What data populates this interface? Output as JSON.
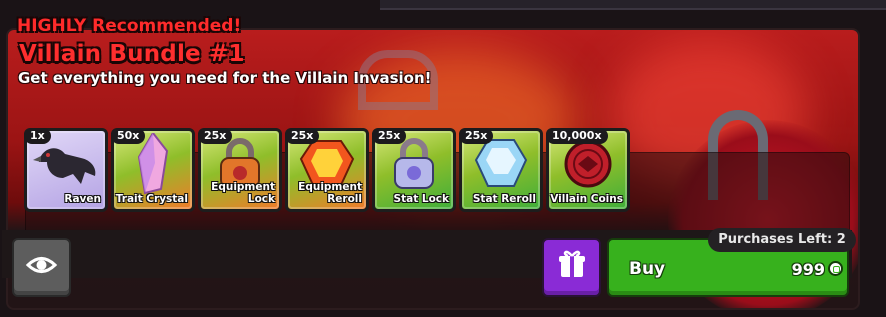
{
  "header": {
    "highlight": "HIGHLY Recommended!",
    "title": "Villain Bundle #1",
    "subtitle": "Get everything you need for the Villain Invasion!"
  },
  "items": [
    {
      "qty": "1x",
      "name": "Raven",
      "icon": "raven-icon",
      "bg": "#c8b8ee"
    },
    {
      "qty": "50x",
      "name": "Trait Crystal",
      "icon": "trait-crystal-icon",
      "bg": "#b8d84a"
    },
    {
      "qty": "25x",
      "name": "Equipment Lock",
      "name_line1": "Equipment",
      "name_line2": "Lock",
      "icon": "equipment-lock-icon",
      "bg": "#b8d84a"
    },
    {
      "qty": "25x",
      "name": "Equipment Reroll",
      "name_line1": "Equipment",
      "name_line2": "Reroll",
      "icon": "equipment-reroll-icon",
      "bg": "#b8d84a"
    },
    {
      "qty": "25x",
      "name": "Stat Lock",
      "icon": "stat-lock-icon",
      "bg": "#b8d84a"
    },
    {
      "qty": "25x",
      "name": "Stat Reroll",
      "icon": "stat-reroll-icon",
      "bg": "#b8d84a"
    },
    {
      "qty": "10,000x",
      "name": "Villain Coins",
      "icon": "villain-coins-icon",
      "bg": "#b8d84a"
    }
  ],
  "actions": {
    "view_icon": "eye-icon",
    "gift_icon": "gift-icon",
    "buy_label": "Buy",
    "price": "999",
    "currency_icon": "robux-icon",
    "purchases_left": "Purchases Left: 2"
  },
  "colors": {
    "title_red": "#ff2e2e",
    "buy_green": "#37b11d",
    "gift_purple": "#8a2bd6",
    "eye_grey": "#5d5d5d"
  }
}
